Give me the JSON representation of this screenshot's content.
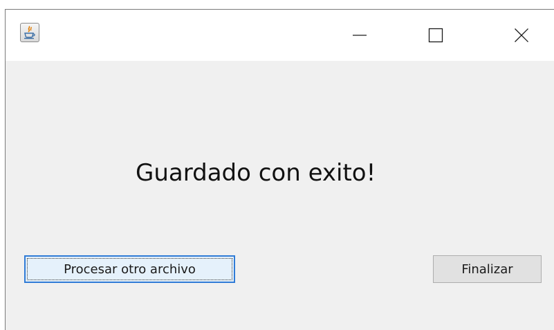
{
  "window": {
    "icon": "java-coffee-icon",
    "controls": {
      "minimize": "minimize-icon",
      "maximize": "maximize-icon",
      "close": "close-icon"
    }
  },
  "dialog": {
    "message": "Guardado con exito!",
    "process_button_label": "Procesar otro archivo",
    "finish_button_label": "Finalizar"
  },
  "colors": {
    "content_background": "#f0f0f0",
    "titlebar_background": "#ffffff",
    "focused_button_background": "#e5f1fb",
    "focused_button_border": "#2f7bd6",
    "button_background": "#e1e1e1"
  }
}
